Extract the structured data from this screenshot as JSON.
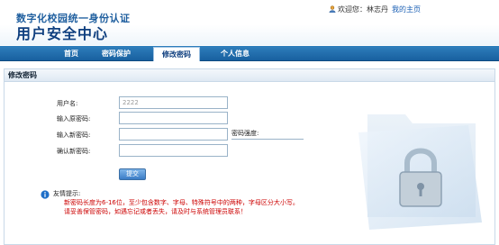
{
  "header": {
    "system_title": "数字化校园统一身份认证",
    "main_title": "用户安全中心",
    "welcome_text": "欢迎您：林志丹",
    "home_link": "我的主页"
  },
  "nav": {
    "items": [
      {
        "label": "首页"
      },
      {
        "label": "密码保护"
      },
      {
        "label": "修改密码"
      },
      {
        "label": "个人信息"
      }
    ],
    "active_index": 2
  },
  "section": {
    "title": "修改密码"
  },
  "form": {
    "username_label": "用户名:",
    "username_value": "2222",
    "old_password_label": "输入原密码:",
    "new_password_label": "输入新密码:",
    "confirm_password_label": "确认新密码:",
    "strength_label": "密码强度:",
    "submit_label": "提交"
  },
  "tips": {
    "title": "友情提示:",
    "lines": [
      "新密码长度为6-16位，至少包含数字、字母、特殊符号中的两种，字母区分大小写。",
      "请妥善保管密码，如遇忘记或者丢失，请及时与系统管理员联系！"
    ]
  },
  "colors": {
    "nav_bg": "#1f6ba8",
    "title_blue": "#0f3f7f",
    "tip_red": "#cc0000"
  },
  "icons": {
    "user": "user-icon",
    "info": "info-icon",
    "folder_lock": "folder-lock-icon"
  }
}
